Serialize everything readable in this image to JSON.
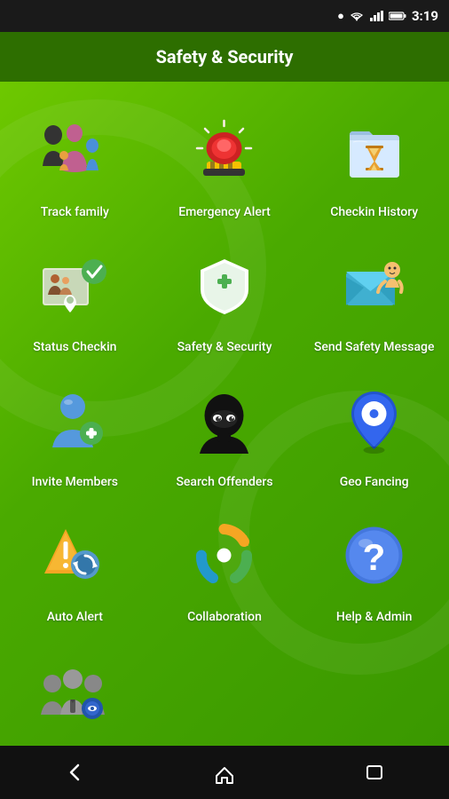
{
  "statusBar": {
    "time": "3:19",
    "icons": [
      "location-pin-icon",
      "wifi-icon",
      "signal-icon",
      "battery-icon"
    ]
  },
  "header": {
    "title": "Safety & Security"
  },
  "grid": {
    "items": [
      {
        "id": "track-family",
        "label": "Track family",
        "icon": "track-family-icon"
      },
      {
        "id": "emergency-alert",
        "label": "Emergency Alert",
        "icon": "emergency-alert-icon"
      },
      {
        "id": "checkin-history",
        "label": "Checkin History",
        "icon": "checkin-history-icon"
      },
      {
        "id": "status-checkin",
        "label": "Status Checkin",
        "icon": "status-checkin-icon"
      },
      {
        "id": "safety-security",
        "label": "Safety & Security",
        "icon": "safety-security-icon"
      },
      {
        "id": "send-safety-message",
        "label": "Send Safety Message",
        "icon": "send-safety-message-icon"
      },
      {
        "id": "invite-members",
        "label": "Invite Members",
        "icon": "invite-members-icon"
      },
      {
        "id": "search-offenders",
        "label": "Search Offenders",
        "icon": "search-offenders-icon"
      },
      {
        "id": "geo-fancing",
        "label": "Geo Fancing",
        "icon": "geo-fancing-icon"
      },
      {
        "id": "auto-alert",
        "label": "Auto Alert",
        "icon": "auto-alert-icon"
      },
      {
        "id": "collaboration",
        "label": "Collaboration",
        "icon": "collaboration-icon"
      },
      {
        "id": "help-admin",
        "label": "Help & Admin",
        "icon": "help-admin-icon"
      },
      {
        "id": "admin-settings",
        "label": "",
        "icon": "admin-settings-icon"
      }
    ]
  },
  "bottomNav": {
    "back_label": "←",
    "home_label": "⌂",
    "recents_label": "▭"
  }
}
